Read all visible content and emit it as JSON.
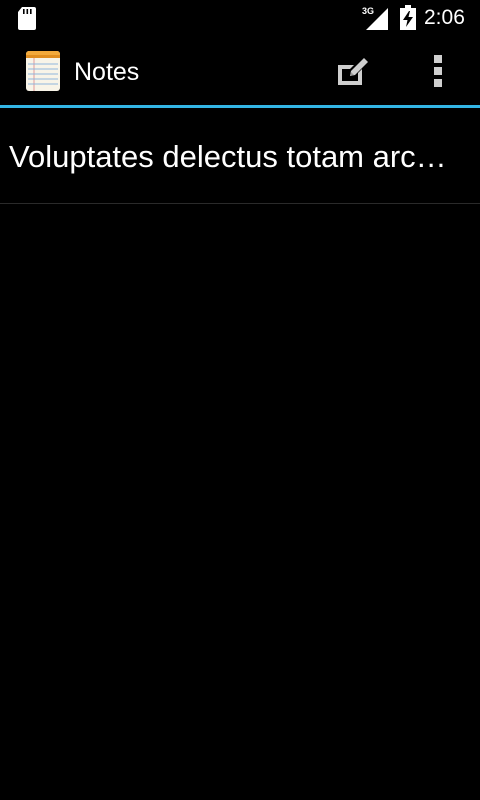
{
  "status_bar": {
    "network_type": "3G",
    "time": "2:06",
    "icons": [
      "sd-card-icon",
      "signal-icon",
      "battery-charging-icon"
    ]
  },
  "action_bar": {
    "app_icon": "notepad-icon",
    "title": "Notes",
    "actions": [
      "compose-note-icon",
      "overflow-menu-icon"
    ],
    "accent_color": "#33b5e5"
  },
  "notes": [
    {
      "title": "Voluptates delectus totam arc…"
    }
  ]
}
